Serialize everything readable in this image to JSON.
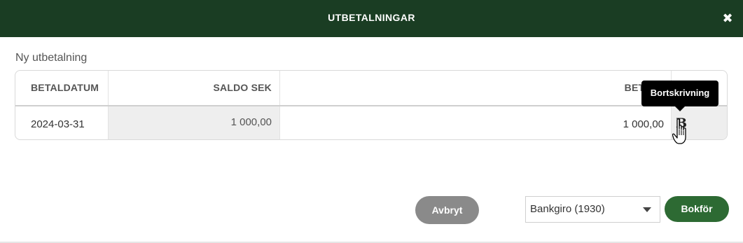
{
  "modal": {
    "title": "UTBETALNINGAR",
    "close_icon": "close-icon",
    "subtitle": "Ny utbetalning"
  },
  "table": {
    "headers": [
      "BETALDATUM",
      "SALDO SEK",
      "BETALT",
      ""
    ],
    "rows": [
      {
        "date": "2024-03-31",
        "balance": "1 000,00",
        "paid": "1 000,00",
        "action_icon": "B"
      }
    ]
  },
  "tooltip": {
    "text": "Bortskrivning"
  },
  "footer": {
    "cancel_label": "Avbryt",
    "account_select_value": "Bankgiro (1930)",
    "book_label": "Bokför"
  },
  "colors": {
    "header_bg": "#1a3d23",
    "book_button": "#2d6a33",
    "cancel_button": "#8a8a8a"
  }
}
